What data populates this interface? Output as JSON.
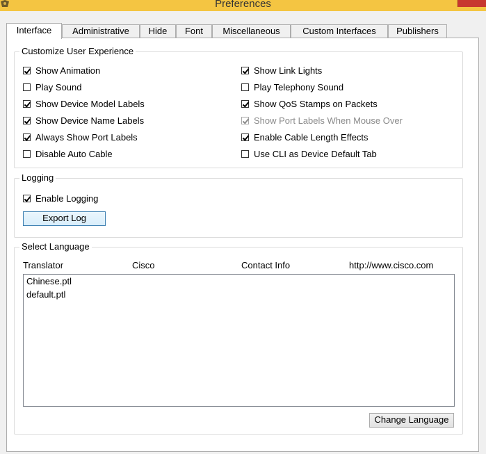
{
  "window": {
    "title": "Preferences"
  },
  "tabs": [
    {
      "label": "Interface",
      "active": true
    },
    {
      "label": "Administrative",
      "active": false
    },
    {
      "label": "Hide",
      "active": false
    },
    {
      "label": "Font",
      "active": false
    },
    {
      "label": "Miscellaneous",
      "active": false
    },
    {
      "label": "Custom Interfaces",
      "active": false
    },
    {
      "label": "Publishers",
      "active": false
    }
  ],
  "customize": {
    "title": "Customize User Experience",
    "left": [
      {
        "label": "Show Animation",
        "checked": true
      },
      {
        "label": "Play Sound",
        "checked": false
      },
      {
        "label": "Show Device Model Labels",
        "checked": true
      },
      {
        "label": "Show Device Name Labels",
        "checked": true
      },
      {
        "label": "Always Show Port Labels",
        "checked": true
      },
      {
        "label": "Disable Auto Cable",
        "checked": false
      }
    ],
    "right": [
      {
        "label": "Show Link Lights",
        "checked": true
      },
      {
        "label": "Play Telephony Sound",
        "checked": false
      },
      {
        "label": "Show QoS Stamps on Packets",
        "checked": true
      },
      {
        "label": "Show Port Labels When Mouse Over",
        "checked": true,
        "disabled": true
      },
      {
        "label": "Enable Cable Length Effects",
        "checked": true
      },
      {
        "label": "Use CLI as Device Default Tab",
        "checked": false
      }
    ]
  },
  "logging": {
    "title": "Logging",
    "enable_label": "Enable Logging",
    "enable_checked": true,
    "export_button": "Export Log"
  },
  "language": {
    "title": "Select Language",
    "translator_label": "Translator",
    "translator_value": "Cisco",
    "contact_label": "Contact Info",
    "contact_value": "http://www.cisco.com",
    "files": [
      "Chinese.ptl",
      "default.ptl"
    ],
    "change_button": "Change Language"
  },
  "colors": {
    "titlebar": "#f4c542",
    "close": "#c7372f",
    "focus_border": "#3c7fb1"
  }
}
